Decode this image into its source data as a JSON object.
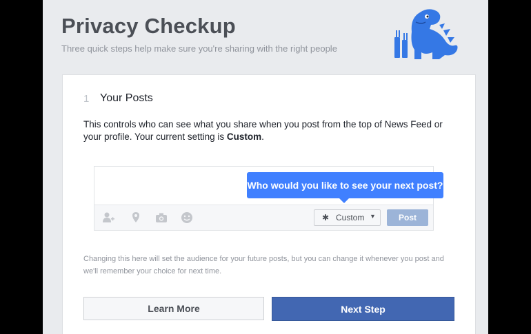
{
  "header": {
    "title": "Privacy Checkup",
    "subtitle": "Three quick steps help make sure you're sharing with the right people"
  },
  "step": {
    "number": "1",
    "title": "Your Posts",
    "description_prefix": "This controls who can see what you share when you post from the top of News Feed or your profile. Your current setting is ",
    "current_setting": "Custom",
    "description_suffix": "."
  },
  "composer": {
    "tooltip": "Who would you like to see your next post?",
    "audience_label": "Custom",
    "post_label": "Post",
    "icons": [
      "tag-friends-icon",
      "location-icon",
      "camera-icon",
      "feeling-icon"
    ]
  },
  "note": "Changing this here will set the audience for your future posts, but you can change it whenever you post and we'll remember your choice for next time.",
  "buttons": {
    "learn_more": "Learn More",
    "next_step": "Next Step"
  },
  "colors": {
    "primary": "#4267b2",
    "tooltip": "#4080ff",
    "mascot": "#3578e5",
    "post_disabled": "#9cb4d8"
  }
}
